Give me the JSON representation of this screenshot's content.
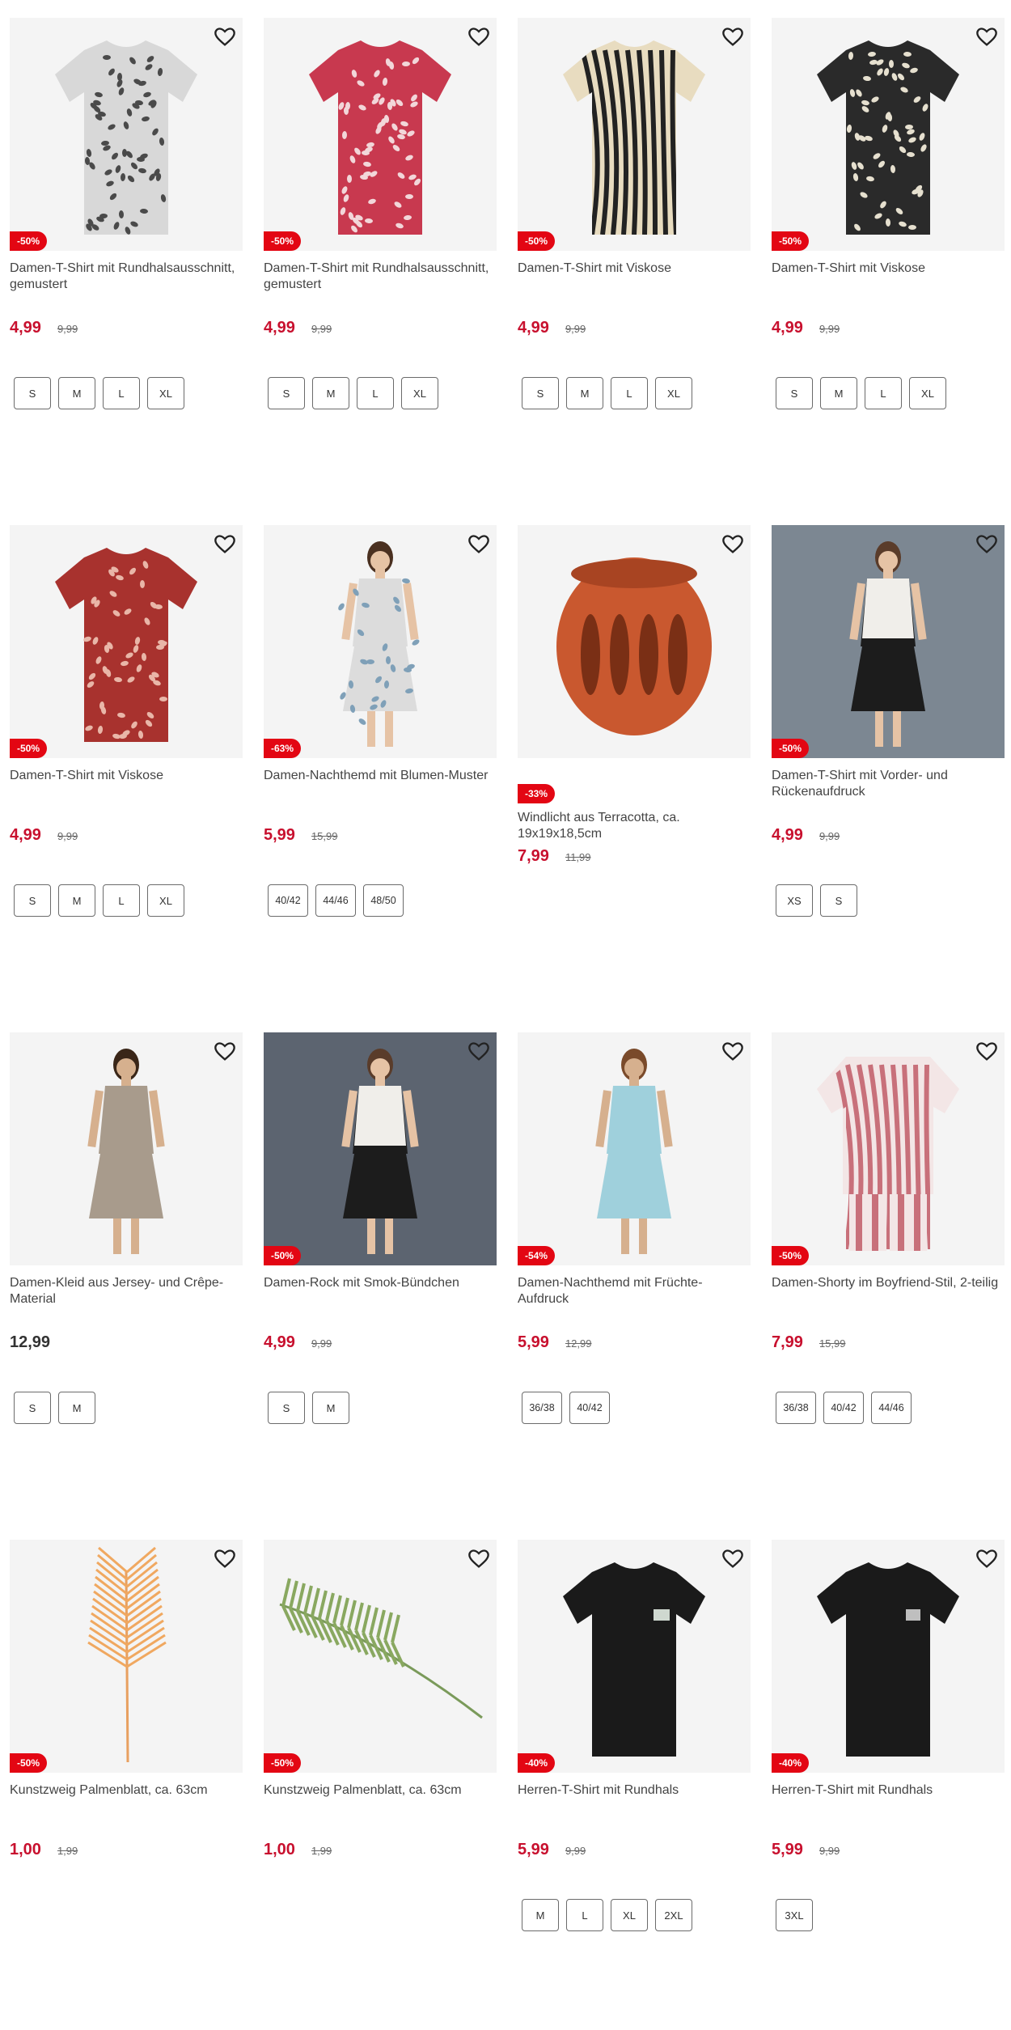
{
  "products": [
    {
      "title": "Damen-T-Shirt mit Rundhalsausschnitt, gemustert",
      "badge": "-50%",
      "price": "4,99",
      "old_price": "9,99",
      "sizes": [
        "S",
        "M",
        "L",
        "XL"
      ],
      "image": "grey-floral-tshirt"
    },
    {
      "title": "Damen-T-Shirt mit Rundhalsausschnitt, gemustert",
      "badge": "-50%",
      "price": "4,99",
      "old_price": "9,99",
      "sizes": [
        "S",
        "M",
        "L",
        "XL"
      ],
      "image": "red-floral-tshirt"
    },
    {
      "title": "Damen-T-Shirt mit Viskose",
      "badge": "-50%",
      "price": "4,99",
      "old_price": "9,99",
      "sizes": [
        "S",
        "M",
        "L",
        "XL"
      ],
      "image": "zebra-tshirt"
    },
    {
      "title": "Damen-T-Shirt mit Viskose",
      "badge": "-50%",
      "price": "4,99",
      "old_price": "9,99",
      "sizes": [
        "S",
        "M",
        "L",
        "XL"
      ],
      "image": "black-leaf-tshirt"
    },
    {
      "title": "Damen-T-Shirt mit Viskose",
      "badge": "-50%",
      "price": "4,99",
      "old_price": "9,99",
      "sizes": [
        "S",
        "M",
        "L",
        "XL"
      ],
      "image": "red-pattern-tshirt"
    },
    {
      "title": "Damen-Nachthemd mit Blumen-Muster",
      "badge": "-63%",
      "price": "5,99",
      "old_price": "15,99",
      "sizes": [
        "40/42",
        "44/46",
        "48/50"
      ],
      "image": "floral-nightgown"
    },
    {
      "title": "Windlicht aus Terracotta, ca. 19x19x18,5cm",
      "badge": "-33%",
      "price": "7,99",
      "old_price": "11,99",
      "sizes": [],
      "image": "terracotta-lantern"
    },
    {
      "title": "Damen-T-Shirt mit Vorder- und Rückenaufdruck",
      "badge": "-50%",
      "price": "4,99",
      "old_price": "9,99",
      "sizes": [
        "XS",
        "S"
      ],
      "image": "white-print-tshirt"
    },
    {
      "title": "Damen-Kleid aus Jersey- und Crêpe-Material",
      "badge": "",
      "price": "12,99",
      "old_price": "",
      "sizes": [
        "S",
        "M"
      ],
      "image": "taupe-dress"
    },
    {
      "title": "Damen-Rock mit Smok-Bündchen",
      "badge": "-50%",
      "price": "4,99",
      "old_price": "9,99",
      "sizes": [
        "S",
        "M"
      ],
      "image": "black-skirt"
    },
    {
      "title": "Damen-Nachthemd mit Früchte-Aufdruck",
      "badge": "-54%",
      "price": "5,99",
      "old_price": "12,99",
      "sizes": [
        "36/38",
        "40/42"
      ],
      "image": "blue-nightgown"
    },
    {
      "title": "Damen-Shorty im Boyfriend-Stil, 2-teilig",
      "badge": "-50%",
      "price": "7,99",
      "old_price": "15,99",
      "sizes": [
        "36/38",
        "40/42",
        "44/46"
      ],
      "image": "striped-pyjama"
    },
    {
      "title": "Kunstzweig Palmenblatt, ca. 63cm",
      "badge": "-50%",
      "price": "1,00",
      "old_price": "1,99",
      "sizes": [],
      "image": "orange-palm-leaf"
    },
    {
      "title": "Kunstzweig Palmenblatt, ca. 63cm",
      "badge": "-50%",
      "price": "1,00",
      "old_price": "1,99",
      "sizes": [],
      "image": "green-palm-leaf"
    },
    {
      "title": "Herren-T-Shirt mit Rundhals",
      "badge": "-40%",
      "price": "5,99",
      "old_price": "9,99",
      "sizes": [
        "M",
        "L",
        "XL",
        "2XL"
      ],
      "image": "black-men-tshirt"
    },
    {
      "title": "Herren-T-Shirt mit Rundhals",
      "badge": "-40%",
      "price": "5,99",
      "old_price": "9,99",
      "sizes": [
        "3XL"
      ],
      "image": "black-men-tshirt-2"
    }
  ],
  "icons": {
    "wishlist": "heart-icon"
  },
  "colors": {
    "sale_red": "#e30613",
    "price_red": "#c8102e",
    "image_bg": "#f4f4f4"
  }
}
